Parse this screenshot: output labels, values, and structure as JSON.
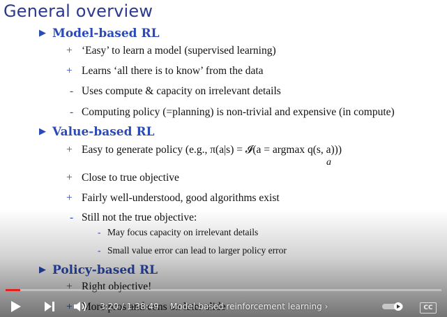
{
  "slide": {
    "title": "General overview",
    "sections": [
      {
        "heading": "Model-based RL",
        "items": [
          {
            "marker": "+",
            "text": "‘Easy’ to learn a model (supervised learning)"
          },
          {
            "marker": "+",
            "text": "Learns ‘all there is to know’ from the data"
          },
          {
            "marker": "-",
            "text": "Uses compute & capacity on irrelevant details"
          },
          {
            "marker": "-",
            "text": "Computing policy (=planning) is non-trivial and expensive (in compute)"
          }
        ]
      },
      {
        "heading": "Value-based RL",
        "items": [
          {
            "marker": "+",
            "text": "Easy to generate policy (e.g., π(a|s) = 𝓘(a = argmax q(s, a)))",
            "subscript": "a"
          },
          {
            "marker": "+",
            "text": "Close to true objective"
          },
          {
            "marker": "+",
            "text": "Fairly well-understood, good algorithms exist"
          },
          {
            "marker": "-",
            "text": "Still not the true objective:"
          }
        ],
        "subitems": [
          {
            "marker": "-",
            "text": "May focus capacity on irrelevant details"
          },
          {
            "marker": "-",
            "text": "Small value error can lead to larger policy error"
          }
        ]
      },
      {
        "heading": "Policy-based RL",
        "items": [
          {
            "marker": "+",
            "text": "Right objective!"
          },
          {
            "marker": "+",
            "text": "More pros and cons on later slide"
          }
        ]
      }
    ]
  },
  "player": {
    "time": "3:20 / 1:38:49",
    "chapter": "Model-based reinforcement learning",
    "progress_fraction": 0.034,
    "cc_label": "CC",
    "colors": {
      "played": "#e22222",
      "track": "#ffffff"
    }
  }
}
